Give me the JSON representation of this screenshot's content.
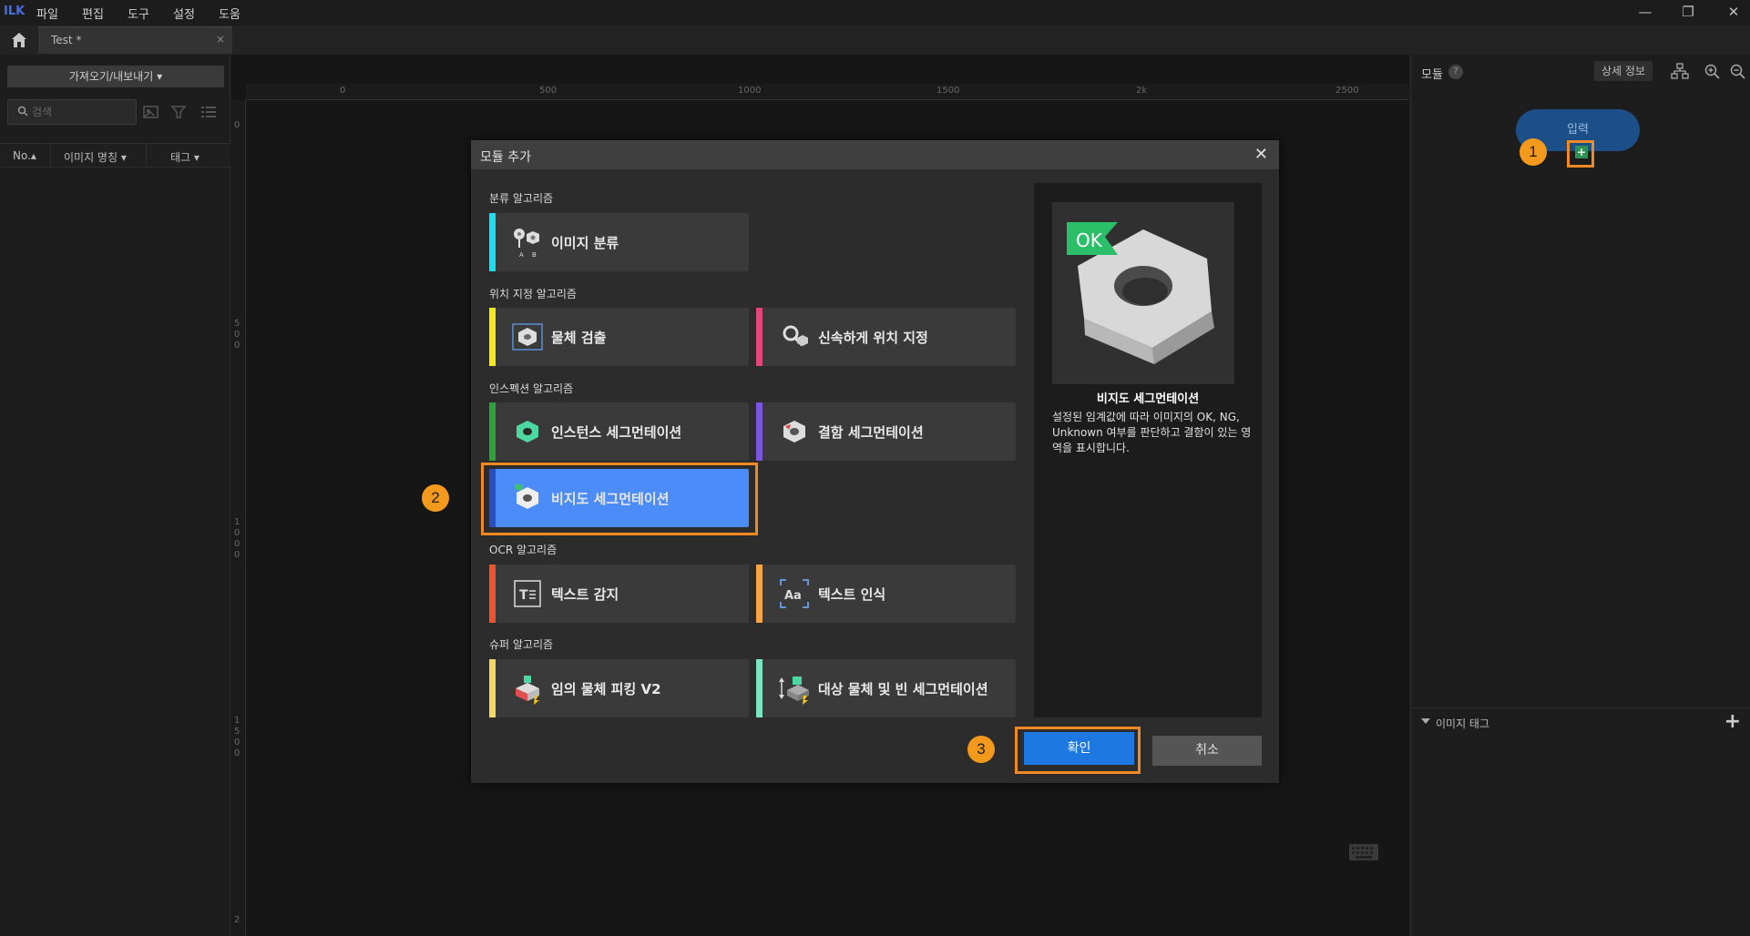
{
  "app": {
    "logo": "ILK"
  },
  "menu": [
    "파일",
    "편집",
    "도구",
    "설정",
    "도움"
  ],
  "tab": {
    "label": "Test *",
    "close": "×"
  },
  "left_panel": {
    "import_export": "가져오기/내보내기 ▾",
    "search_placeholder": "검색",
    "columns": [
      "No.▴",
      "이미지 명칭 ▾",
      "태그 ▾"
    ]
  },
  "ruler": {
    "top_ticks": [
      "0",
      "500",
      "1000",
      "1500",
      "2k",
      "2500"
    ],
    "left_ticks": [
      "0",
      "5\n0\n0",
      "1\n0\n0\n0",
      "1\n5\n0\n0",
      "2"
    ]
  },
  "right_panel": {
    "title": "모듈",
    "help": "?",
    "details": "상세 정보",
    "input_node": "입력",
    "add_node": "+",
    "image_tag": "이미지 태그",
    "image_tag_add": "+"
  },
  "badges": [
    "1",
    "2",
    "3"
  ],
  "dialog": {
    "title": "모듈 추가",
    "close": "✕",
    "sections": {
      "classification": "분류 알고리즘",
      "positioning": "위치 지정 알고리즘",
      "inspection": "인스펙션 알고리즘",
      "ocr": "OCR 알고리즘",
      "super": "슈퍼 알고리즘"
    },
    "cards": {
      "image_classification": "이미지 분류",
      "object_detection": "물체 검출",
      "fast_positioning": "신속하게 위치 지정",
      "instance_segmentation": "인스턴스 세그먼테이션",
      "defect_segmentation": "결함 세그먼테이션",
      "unsupervised_segmentation": "비지도 세그먼테이션",
      "text_detection": "텍스트 감지",
      "text_recognition": "텍스트 인식",
      "picking_v2": "임의 물체 피킹 V2",
      "object_bin_segmentation": "대상 물체 및 빈 세그먼테이션"
    },
    "preview": {
      "badge": "OK",
      "title": "비지도 세그먼테이션",
      "description": "설정된 임계값에 따라 이미지의 OK, NG, Unknown 여부를 판단하고 결함이 있는 영역을 표시합니다."
    },
    "ok": "확인",
    "cancel": "취소"
  },
  "colors": {
    "accent_orange": "#f08a24",
    "selected_blue": "#4b8cf8",
    "ok_blue": "#1e78e2",
    "cyan": "#18e0f0",
    "yellow": "#f5e81a",
    "pink": "#e0457b",
    "green": "#2ca33c",
    "purple": "#7a56e0",
    "red_orange": "#f0532c",
    "orange": "#f5a545",
    "light_yellow": "#f5d860",
    "mint": "#7ee2c0"
  }
}
